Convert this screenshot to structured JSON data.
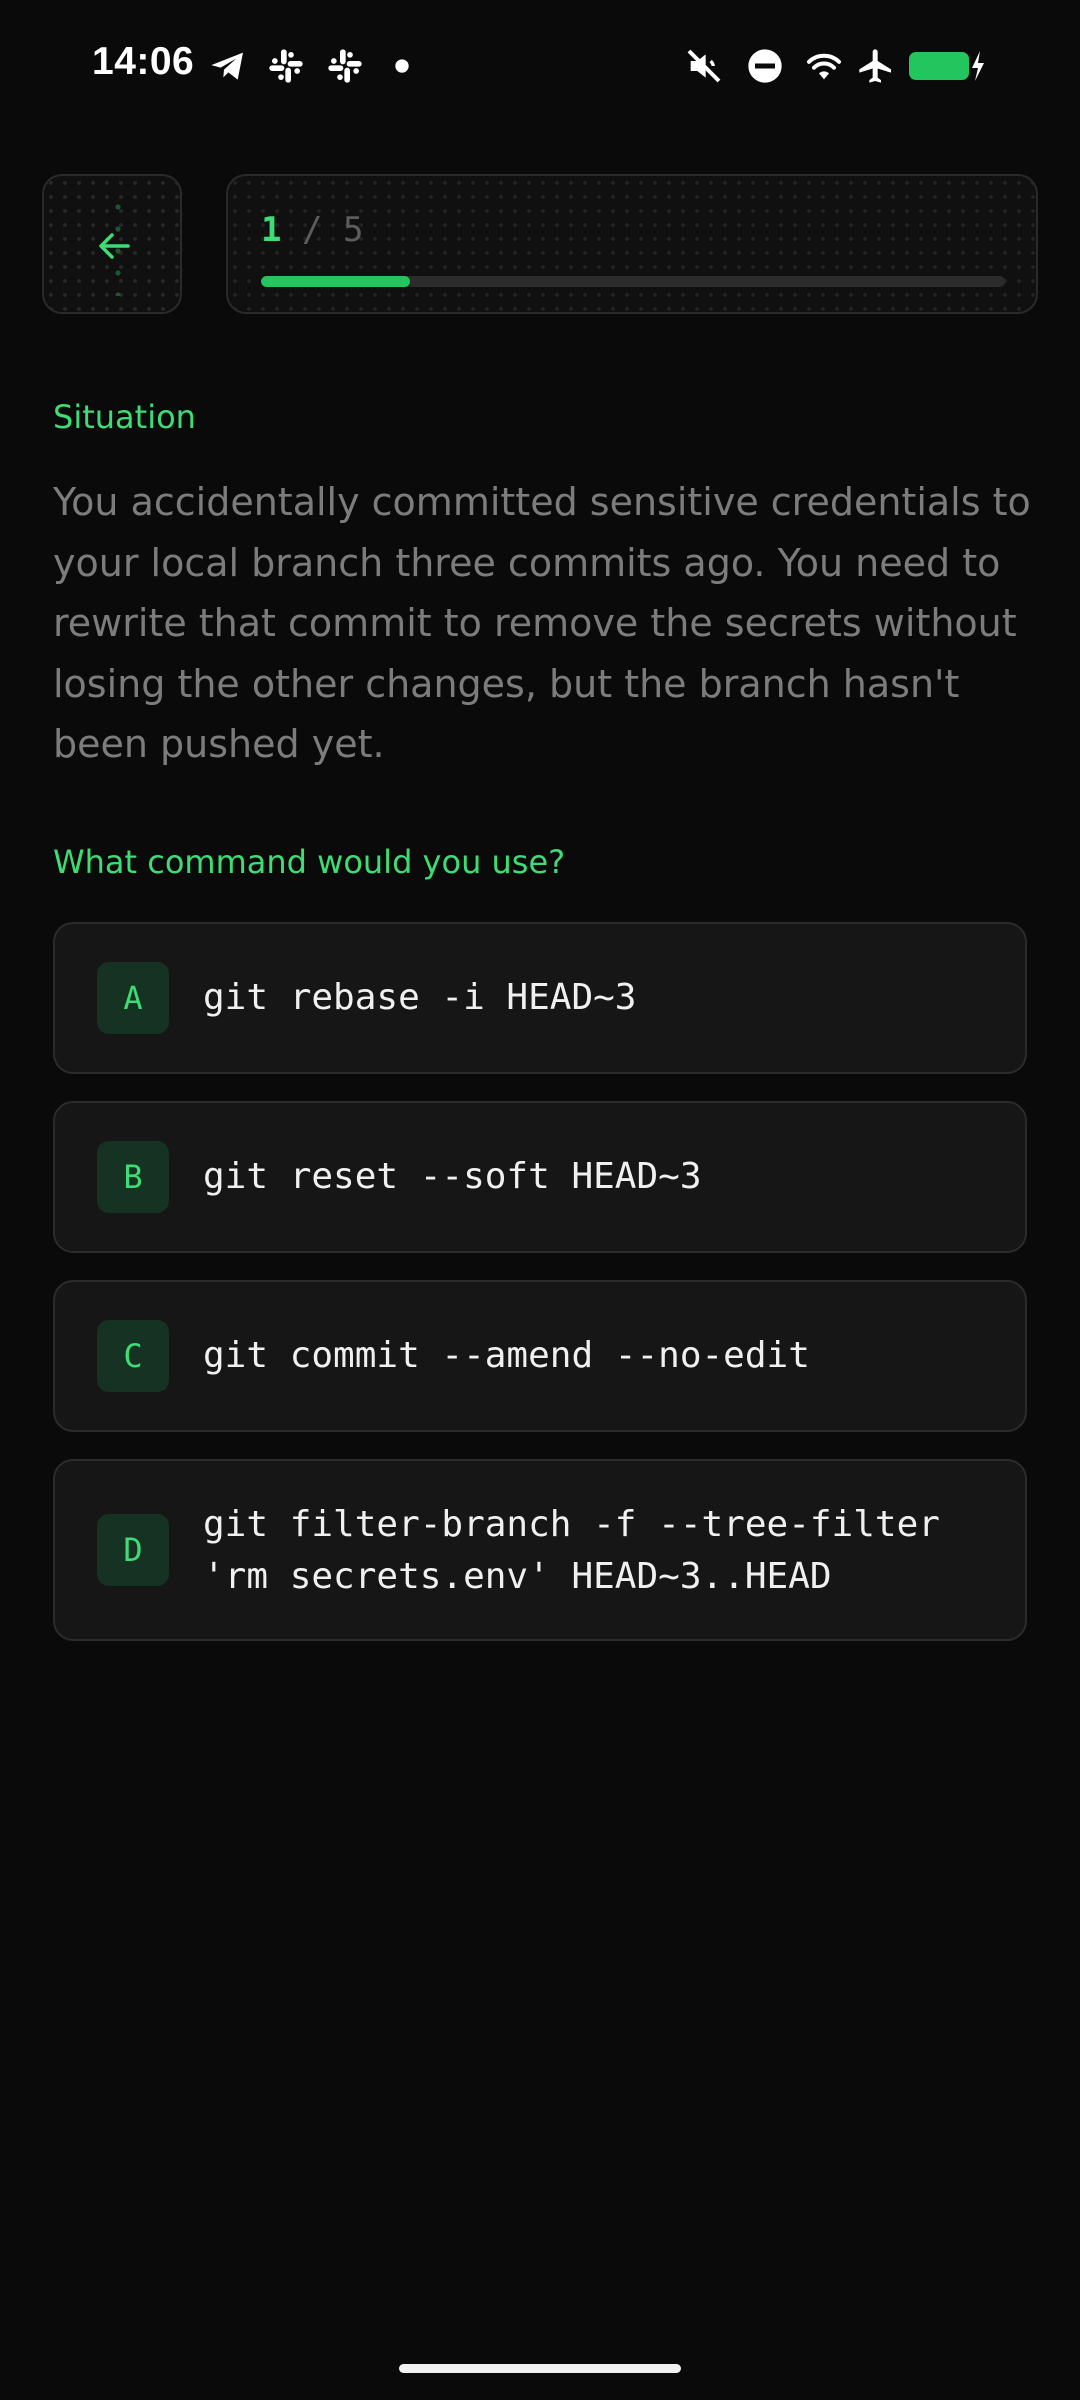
{
  "status_bar": {
    "time": "14:06",
    "left_icons": [
      "telegram-icon",
      "slack-icon",
      "slack-icon",
      "dot-icon"
    ],
    "right_icons": [
      "mute-icon",
      "do-not-disturb-icon",
      "wifi-icon",
      "airplane-icon",
      "battery-charging-icon"
    ]
  },
  "header": {
    "back_icon": "arrow-left-icon",
    "progress": {
      "current": "1",
      "separator": "/",
      "total": "5",
      "fraction": 0.2
    }
  },
  "situation": {
    "label": "Situation",
    "text": "You accidentally committed sensitive credentials to your local branch three commits ago. You need to rewrite that commit to remove the secrets without losing the other changes, but the branch hasn't been pushed yet."
  },
  "question": {
    "label": "What command would you use?"
  },
  "options": [
    {
      "letter": "A",
      "command": "git rebase -i HEAD~3"
    },
    {
      "letter": "B",
      "command": "git reset --soft HEAD~3"
    },
    {
      "letter": "C",
      "command": "git commit --amend --no-edit"
    },
    {
      "letter": "D",
      "command": "git filter-branch -f --tree-filter 'rm secrets.env' HEAD~3..HEAD"
    }
  ],
  "colors": {
    "accent": "#3ddc74",
    "progress_fill": "#22c55e",
    "background": "#0a0a0a",
    "battery": "#22c55e"
  }
}
